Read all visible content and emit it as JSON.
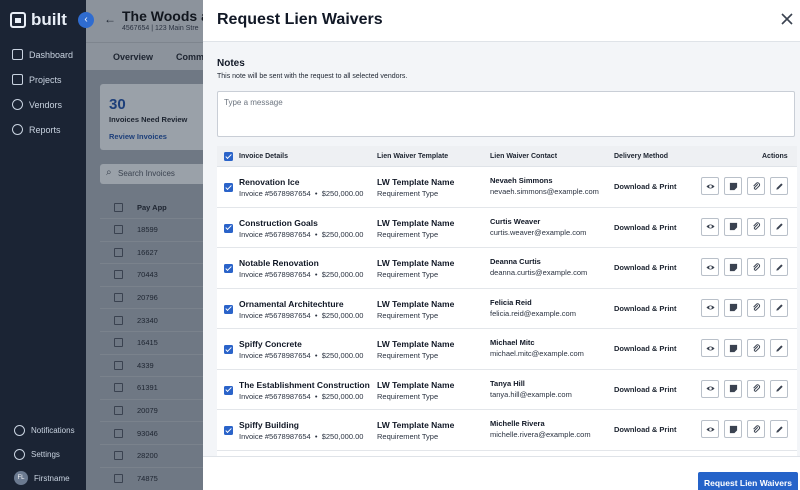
{
  "app": {
    "logo": "built",
    "nav": [
      {
        "label": "Dashboard",
        "icon": "dashboard-icon"
      },
      {
        "label": "Projects",
        "icon": "projects-icon"
      },
      {
        "label": "Vendors",
        "icon": "vendors-icon"
      },
      {
        "label": "Reports",
        "icon": "reports-icon"
      }
    ],
    "bottom": {
      "notifications": "Notifications",
      "settings": "Settings",
      "user": "Firstname",
      "user_initials": "FL"
    }
  },
  "background": {
    "title": "The Woods at S",
    "subtitle": "4567654 | 123 Main Stre",
    "tabs": [
      "Overview",
      "Commi"
    ],
    "card": {
      "count": "30",
      "label": "Invoices Need Review",
      "link": "Review Invoices"
    },
    "search_placeholder": "Search Invoices",
    "table_header": "Pay App",
    "pay_apps": [
      "18599",
      "16627",
      "70443",
      "20796",
      "23340",
      "16415",
      "4339",
      "61391",
      "20079",
      "93046",
      "28200",
      "74875"
    ]
  },
  "modal": {
    "title": "Request Lien Waivers",
    "notes_title": "Notes",
    "notes_subtitle": "This note will be sent with the request to all selected vendors.",
    "notes_placeholder": "Type a message",
    "columns": {
      "invoice_details": "Invoice Details",
      "template": "Lien Waiver Template",
      "contact": "Lien Waiver Contact",
      "delivery": "Delivery Method",
      "actions": "Actions"
    },
    "rows": [
      {
        "vendor": "Renovation Ice",
        "invoice": "Invoice #5678987654",
        "amount": "$250,000.00",
        "template": "LW Template Name",
        "requirement": "Requirement Type",
        "contact_name": "Nevaeh Simmons",
        "contact_email": "nevaeh.simmons@example.com",
        "delivery": "Download & Print"
      },
      {
        "vendor": "Construction Goals",
        "invoice": "Invoice #5678987654",
        "amount": "$250,000.00",
        "template": "LW Template Name",
        "requirement": "Requirement Type",
        "contact_name": "Curtis Weaver",
        "contact_email": "curtis.weaver@example.com",
        "delivery": "Download & Print"
      },
      {
        "vendor": "Notable Renovation",
        "invoice": "Invoice #5678987654",
        "amount": "$250,000.00",
        "template": "LW Template Name",
        "requirement": "Requirement Type",
        "contact_name": "Deanna Curtis",
        "contact_email": "deanna.curtis@example.com",
        "delivery": "Download & Print"
      },
      {
        "vendor": "Ornamental Architechture",
        "invoice": "Invoice #5678987654",
        "amount": "$250,000.00",
        "template": "LW Template Name",
        "requirement": "Requirement Type",
        "contact_name": "Felicia Reid",
        "contact_email": "felicia.reid@example.com",
        "delivery": "Download & Print"
      },
      {
        "vendor": "Spiffy Concrete",
        "invoice": "Invoice #5678987654",
        "amount": "$250,000.00",
        "template": "LW Template Name",
        "requirement": "Requirement Type",
        "contact_name": "Michael Mitc",
        "contact_email": "michael.mitc@example.com",
        "delivery": "Download & Print"
      },
      {
        "vendor": "The Establishment Construction",
        "invoice": "Invoice #5678987654",
        "amount": "$250,000.00",
        "template": "LW Template Name",
        "requirement": "Requirement Type",
        "contact_name": "Tanya Hill",
        "contact_email": "tanya.hill@example.com",
        "delivery": "Download & Print"
      },
      {
        "vendor": "Spiffy Building",
        "invoice": "Invoice #5678987654",
        "amount": "$250,000.00",
        "template": "LW Template Name",
        "requirement": "Requirement Type",
        "contact_name": "Michelle Rivera",
        "contact_email": "michelle.rivera@example.com",
        "delivery": "Download & Print"
      },
      {
        "vendor": "",
        "invoice": "",
        "amount": "",
        "template": "",
        "requirement": "",
        "contact_name": "",
        "contact_email": "",
        "delivery": ""
      }
    ],
    "row_actions": [
      "view-icon",
      "note-icon",
      "attachment-icon",
      "edit-icon"
    ],
    "submit_label": "Request Lien Waivers",
    "accent": "#2563c9"
  }
}
